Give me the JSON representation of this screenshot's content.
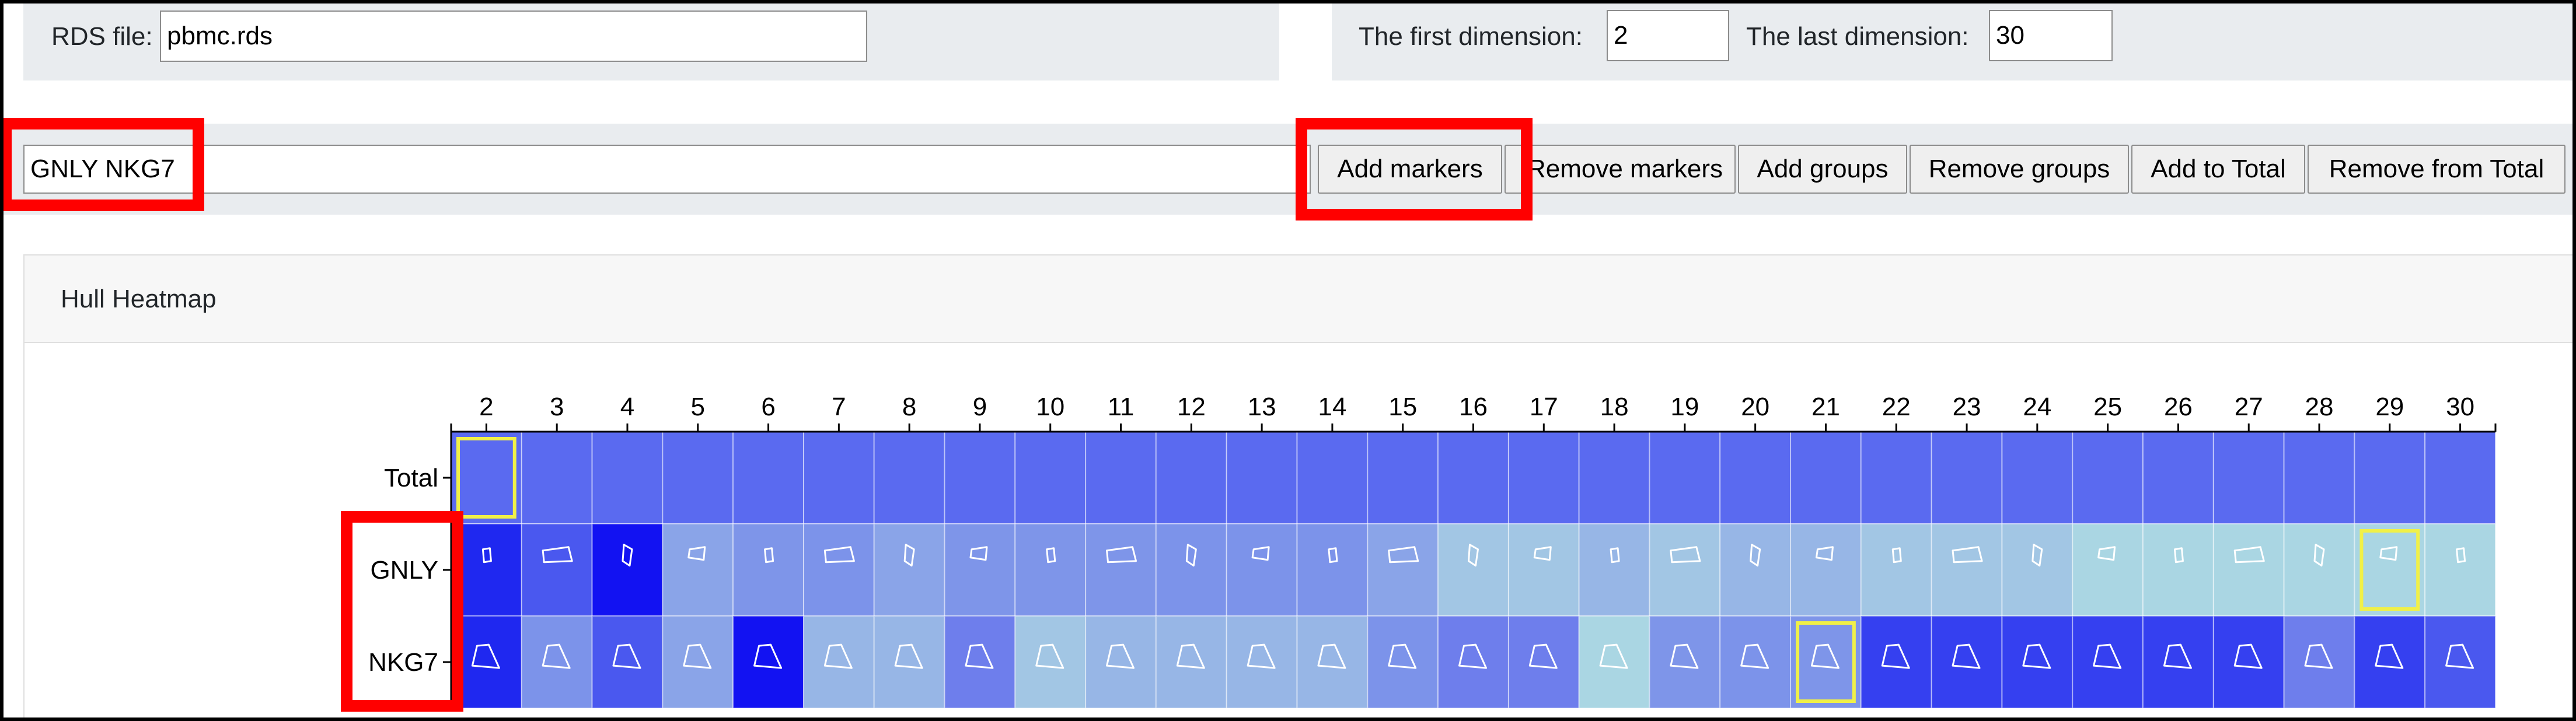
{
  "rds": {
    "label": "RDS file:",
    "value": "pbmc.rds"
  },
  "dims": {
    "first_label": "The first dimension:",
    "first_value": "2",
    "last_label": "The last dimension:",
    "last_value": "30"
  },
  "markers": {
    "input_value": "GNLY NKG7"
  },
  "buttons": {
    "add_markers": "Add markers",
    "remove_markers": "Remove markers",
    "add_groups": "Add groups",
    "remove_groups": "Remove groups",
    "add_to_total": "Add to Total",
    "remove_from_total": "Remove from Total"
  },
  "card": {
    "title": "Hull Heatmap"
  },
  "colors": {
    "highlight": "#ff0000",
    "selected_cell": "#f0f048",
    "hull_stroke": "#ffffff"
  },
  "chart_data": {
    "type": "heatmap",
    "x": [
      2,
      3,
      4,
      5,
      6,
      7,
      8,
      9,
      10,
      11,
      12,
      13,
      14,
      15,
      16,
      17,
      18,
      19,
      20,
      21,
      22,
      23,
      24,
      25,
      26,
      27,
      28,
      29,
      30
    ],
    "rows": [
      "Total",
      "GNLY",
      "NKG7"
    ],
    "cell_colors": [
      [
        "#5a6af0",
        "#5a6af0",
        "#5a6af0",
        "#5a6af0",
        "#5a6af0",
        "#5a6af0",
        "#5a6af0",
        "#5a6af0",
        "#5a6af0",
        "#5a6af0",
        "#5a6af0",
        "#5a6af0",
        "#5a6af0",
        "#5a6af0",
        "#5a6af0",
        "#5a6af0",
        "#5a6af0",
        "#5a6af0",
        "#5a6af0",
        "#5a6af0",
        "#5a6af0",
        "#5a6af0",
        "#5a6af0",
        "#5a6af0",
        "#5a6af0",
        "#5a6af0",
        "#5a6af0",
        "#5a6af0",
        "#5a6af0"
      ],
      [
        "#1f28f0",
        "#4a58ef",
        "#1212f2",
        "#8aa4e8",
        "#7e95e9",
        "#7c93ea",
        "#8aa4e8",
        "#7e95e9",
        "#7e95e9",
        "#7e95e9",
        "#7c93ea",
        "#7c93ea",
        "#7c93ea",
        "#8aa4e8",
        "#a2c6e4",
        "#a2c6e4",
        "#97b6e6",
        "#a2c6e4",
        "#97b6e6",
        "#97b6e6",
        "#a2c6e4",
        "#a2c6e4",
        "#a2c6e4",
        "#aad6e3",
        "#aad6e3",
        "#aad6e3",
        "#aad6e3",
        "#aad6e3",
        "#aad6e3"
      ],
      [
        "#1f28f0",
        "#7c93ea",
        "#4a58ef",
        "#8aa4e8",
        "#1212f2",
        "#97b6e6",
        "#97b6e6",
        "#6e7eec",
        "#a2c6e4",
        "#97b6e6",
        "#97b6e6",
        "#97b6e6",
        "#97b6e6",
        "#7c93ea",
        "#6e7eec",
        "#6e7eec",
        "#aad6e3",
        "#7e95e9",
        "#7c93ea",
        "#7e95e9",
        "#3540f0",
        "#3540f0",
        "#3540f0",
        "#3540f0",
        "#3540f0",
        "#3540f0",
        "#6e7eec",
        "#3540f0",
        "#4a58ef"
      ]
    ],
    "selected": [
      {
        "row": "Total",
        "x": 2
      },
      {
        "row": "GNLY",
        "x": 29
      },
      {
        "row": "NKG7",
        "x": 21
      }
    ],
    "grid": true
  }
}
